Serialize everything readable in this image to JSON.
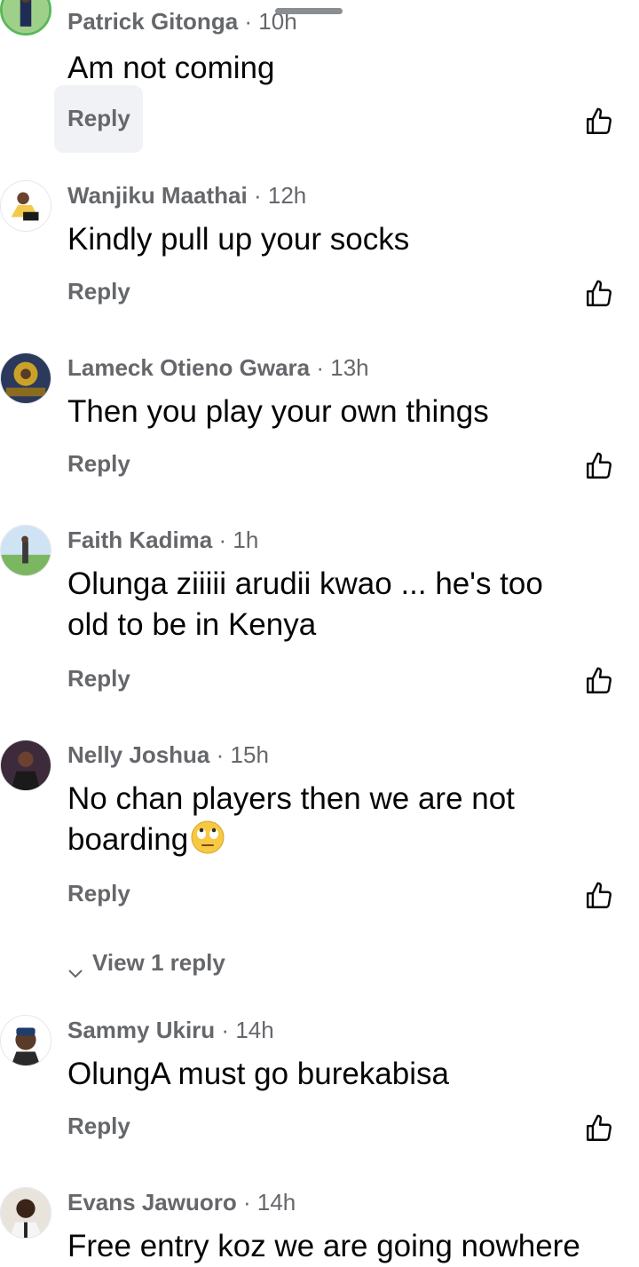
{
  "comments": [
    {
      "name": "Patrick Gitonga",
      "time": "10h",
      "text": "Am not coming",
      "reply": "Reply"
    },
    {
      "name": "Wanjiku Maathai",
      "time": "12h",
      "text": "Kindly pull up your socks",
      "reply": "Reply"
    },
    {
      "name": "Lameck Otieno Gwara",
      "time": "13h",
      "text": "Then you play your own things",
      "reply": "Reply"
    },
    {
      "name": "Faith Kadima",
      "time": "1h",
      "text": "Olunga ziiiii arudii kwao ... he's too\nold to be in Kenya",
      "reply": "Reply"
    },
    {
      "name": "Nelly Joshua",
      "time": "15h",
      "text": "No chan players then we are not\nboarding",
      "reply": "Reply",
      "emoji": "face-with-rolling-eyes-emoji"
    },
    {
      "name": "Sammy Ukiru",
      "time": "14h",
      "text": "OlungA must go burekabisa",
      "reply": "Reply"
    },
    {
      "name": "Evans Jawuoro",
      "time": "14h",
      "text": "Free entry koz we are going nowhere"
    }
  ],
  "view_replies": "View 1 reply",
  "separator": "·",
  "icons": {
    "like": "thumbs-up-outline-icon",
    "expand": "chevron-down-icon"
  },
  "colors": {
    "meta": "#65676b",
    "text": "#050505",
    "reply_highlight": "#f0f2f5"
  }
}
